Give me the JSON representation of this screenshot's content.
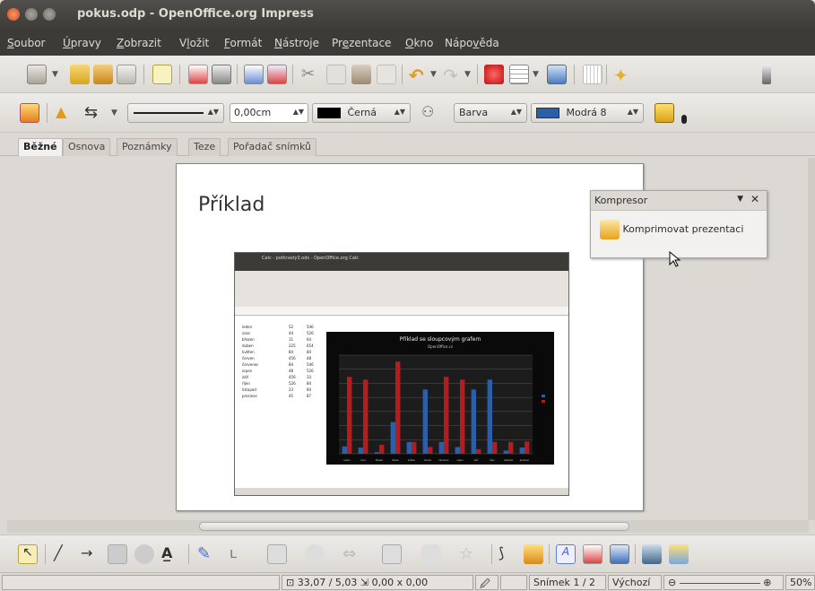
{
  "window": {
    "title": "pokus.odp - OpenOffice.org Impress"
  },
  "menu": [
    "Soubor",
    "Úpravy",
    "Zobrazit",
    "Vložit",
    "Formát",
    "Nástroje",
    "Prezentace",
    "Okno",
    "Nápověda"
  ],
  "line_toolbar": {
    "width_value": "0,00cm",
    "color_value": "Černá",
    "fill_type": "Barva",
    "fill_color": "Modrá 8"
  },
  "tabs": [
    "Běžné",
    "Osnova",
    "Poznámky",
    "Teze",
    "Pořadač snímků"
  ],
  "active_tab": "Běžné",
  "slide": {
    "title": "Příklad"
  },
  "embedded": {
    "title": "Calc - potkrasty3.ods - OpenOffice.org Calc",
    "chart_title": "Příklad se sloupcovým grafem",
    "chart_subtitle": "OpenOffice.cz",
    "months": [
      "leden",
      "únor",
      "březen",
      "duben",
      "květen",
      "červen",
      "červenec",
      "srpen",
      "září",
      "říjen",
      "listopad",
      "prosinec"
    ],
    "col_b": [
      "52",
      "44",
      "11",
      "225",
      "84",
      "456",
      "84",
      "48",
      "456",
      "526",
      "23",
      "45"
    ],
    "col_c": [
      "546",
      "526",
      "64",
      "654",
      "84",
      "48",
      "546",
      "526",
      "33",
      "84",
      "84",
      "87"
    ]
  },
  "chart_data": {
    "type": "bar",
    "title": "Příklad se sloupcovým grafem",
    "subtitle": "OpenOffice.cz",
    "categories": [
      "leden",
      "únor",
      "březen",
      "duben",
      "květen",
      "červen",
      "červenec",
      "srpen",
      "září",
      "říjen",
      "listopad",
      "prosinec"
    ],
    "series": [
      {
        "values": [
          52,
          44,
          11,
          225,
          84,
          456,
          84,
          48,
          456,
          526,
          23,
          45
        ],
        "color": "#2b5fa8"
      },
      {
        "values": [
          546,
          526,
          64,
          654,
          84,
          48,
          546,
          526,
          33,
          84,
          84,
          87
        ],
        "color": "#b71c1c"
      }
    ],
    "ylim": [
      0,
      700
    ],
    "grid": true
  },
  "panel": {
    "title": "Kompresor",
    "item": "Komprimovat prezentaci"
  },
  "status": {
    "position": "33,07 / 5,03",
    "size": "0,00 x 0,00",
    "slide": "Snímek 1 / 2",
    "layout": "Výchozí",
    "zoom": "50%"
  },
  "colors": {
    "titlebar": "#3c3b37",
    "accent": "#f07746",
    "fill_swatch": "#2b5fa8"
  }
}
